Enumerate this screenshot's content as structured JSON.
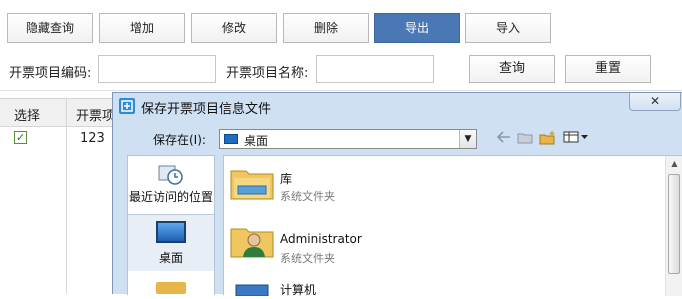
{
  "toolbar": {
    "buttons": [
      "隐藏查询",
      "增加",
      "修改",
      "删除",
      "导出",
      "导入"
    ],
    "active": "导出"
  },
  "search": {
    "code_label": "开票项目编码:",
    "code_value": "",
    "name_label": "开票项目名称:",
    "name_value": "",
    "query_button": "查询",
    "reset_button": "重置"
  },
  "table": {
    "columns": [
      "选择",
      "开票项"
    ],
    "rows": [
      {
        "checked": true,
        "check_glyph": "✓",
        "code": "123"
      }
    ]
  },
  "dialog": {
    "title": "保存开票项目信息文件",
    "close_glyph": "✕",
    "save_in_label": "保存在(I):",
    "location": "桌面",
    "places": [
      "最近访问的位置",
      "桌面"
    ],
    "items": [
      {
        "name": "库",
        "type": "系统文件夹",
        "icon": "library-folder-icon"
      },
      {
        "name": "Administrator",
        "type": "系统文件夹",
        "icon": "user-folder-icon"
      },
      {
        "name": "计算机",
        "type": "",
        "icon": "computer-icon"
      }
    ]
  },
  "colors": {
    "active_button": "#4a78b4",
    "dialog_frame": "#cfe0f3"
  }
}
